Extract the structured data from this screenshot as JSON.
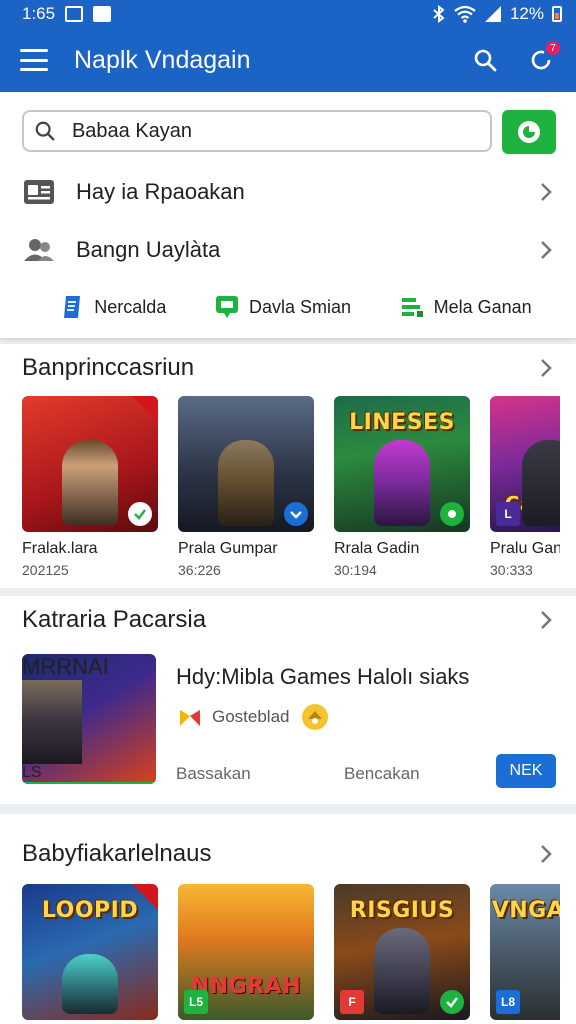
{
  "status_bar": {
    "time": "1:65",
    "battery": "12%"
  },
  "app_bar": {
    "title": "Naplk Vndagain",
    "notification_count": "7"
  },
  "search": {
    "value": "Babaa Kayan"
  },
  "menu": [
    {
      "label": "Hay ia Rpaoakan",
      "icon": "id-card-icon"
    },
    {
      "label": "Bangn Uaylàta",
      "icon": "people-icon"
    }
  ],
  "quick_links": [
    {
      "label": "Nercalda",
      "icon": "document-icon",
      "color": "#1b6ed6"
    },
    {
      "label": "Davla Smian",
      "icon": "chat-icon",
      "color": "#1db33e"
    },
    {
      "label": "Mela Ganan",
      "icon": "list-icon",
      "color": "#1db33e"
    }
  ],
  "section1": {
    "title": "Banprinccasriun",
    "games": [
      {
        "name": "Fralak.lara",
        "meta": "202125"
      },
      {
        "name": "Prala Gumpar",
        "meta": "36:226"
      },
      {
        "name": "Rrala Gadin",
        "meta": "30:194"
      },
      {
        "name": "Pralu Gan",
        "meta": "30:333"
      }
    ],
    "art_text": [
      "",
      "",
      "LINESES",
      "Cal"
    ]
  },
  "section2": {
    "title": "Katraria Pacarsia",
    "featured": {
      "art_text": "MRRNAI",
      "title": "Hdy:Mibla Games Halolı siaks",
      "developer": "Gosteblad",
      "foot_left": "Bassakan",
      "foot_right": "Bencakan",
      "button": "NEK"
    }
  },
  "section3": {
    "title": "Babyfiakarlelnaus",
    "art_text": [
      "LOOPID",
      "NNGRAH",
      "RISGIUS",
      "VNGA"
    ]
  },
  "colors": {
    "primary": "#1b64c6",
    "accent_green": "#1db33e",
    "button_blue": "#1b6ed6"
  }
}
